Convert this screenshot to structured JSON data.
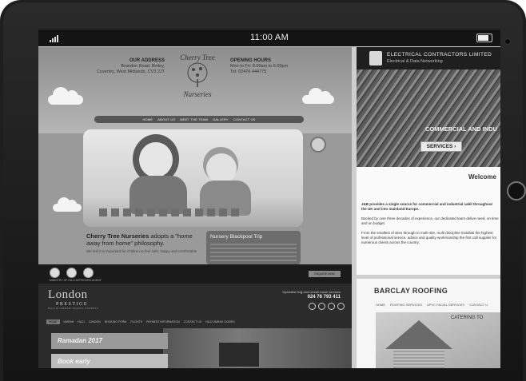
{
  "status_bar": {
    "time": "11:00 AM"
  },
  "cherry_tree": {
    "address_label": "OUR ADDRESS",
    "address_line1": "Brandon Road, Binley,",
    "address_line2": "Coventry, West Midlands, CV3 2JT",
    "logo_line1": "Cherry Tree",
    "logo_line2": "Nurseries",
    "hours_label": "OPENING HOURS",
    "hours_line1": "Mon to Fri: 8.00am to 6.00pm",
    "hours_line2": "Tel: 02476 444775",
    "nav": [
      "HOME",
      "ABOUT US",
      "MEET THE TEAM",
      "GALLERY",
      "CONTACT US"
    ],
    "intro_title_bold": "Cherry Tree Nurseries",
    "intro_title_rest": "adopts a \"home away from home\" philosophy.",
    "intro_body": "We feel it is important for children to feel safe, happy and comfortable",
    "trip_title": "Nursery Blackpool Trip"
  },
  "london_prestige": {
    "ministry": "MINISTRY OF HAJJ APPROVED AGENT",
    "enquire": "ENQUIRE NOW",
    "logo_main": "London",
    "logo_sub": "PRESTIGE",
    "logo_tag": "HAJJ & UMRAH TRAVEL EXPERTS",
    "contact_line": "Specialist Hajj and Umrah travel services",
    "phone": "024 76 793 411",
    "nav": [
      "HOME",
      "UMRAH",
      "HAJJ",
      "LONDON",
      "BOOKING FORM",
      "FLIGHTS",
      "PAYMENT INFORMATION",
      "CONTACT US",
      "HAJJ UMRAH GUIDES"
    ],
    "card1": "Ramadan 2017",
    "card2": "Book early"
  },
  "jb": {
    "name": "ELECTRICAL CONTRACTORS LIMITED",
    "tagline": "Electrical & Data Networking",
    "hero_text": "COMMERCIAL AND INDU",
    "services": "SERVICES ›",
    "welcome": "Welcome",
    "text1": "J&B provides a single source for commercial and industrial cabli throughout the UK and into mainland Europe.",
    "text2": "Backed by over three decades of experience, our dedicated team delive need, on time and on budget.",
    "text3": "From the smallest of sites through to multi-site, multi discipline installati the highest level of professional service, advice and quality workmanship the first call supplier for numerous clients across the country."
  },
  "barclay": {
    "title": "BARCLAY ROOFING",
    "nav": [
      "HOME",
      "ROOFING SERVICES",
      "UPVC FACIAL SERVICES",
      "CONTACT U"
    ],
    "catering": "CATERING TO"
  }
}
